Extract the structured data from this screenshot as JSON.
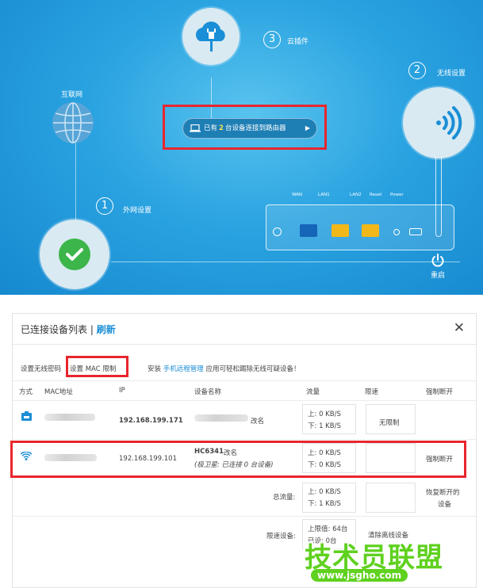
{
  "dashboard": {
    "internet_label": "互联网",
    "wan_settings": {
      "number": "1",
      "label": "外网设置"
    },
    "cloud_plugin": {
      "number": "3",
      "label": "云插件"
    },
    "wireless_settings": {
      "number": "2",
      "label": "无线设置"
    },
    "devices_pill": {
      "prefix": "已有",
      "count": "2",
      "suffix": "台设备连接到路由器",
      "arrow": "▶"
    },
    "router_ports": [
      "WAN",
      "LAN1",
      "LAN2",
      "Reset",
      "Power"
    ],
    "reboot_label": "重启",
    "colors": {
      "background": "#2aa3e1",
      "highlight": "#e8262d",
      "wan_port": "#1565b8",
      "lan_port": "#f2b81a",
      "ok": "#3cb54a"
    }
  },
  "modal": {
    "title": "已连接设备列表",
    "separator": "|",
    "refresh": "刷新",
    "close": "✕",
    "toolbar": {
      "wireless_password": "设置无线密码",
      "mac_limit": "设置 MAC 限制",
      "install_prefix": "安装",
      "remote_app": "手机远程管理",
      "install_suffix": "应用可轻松踢除无线可疑设备！"
    },
    "columns": [
      "方式",
      "MAC地址",
      "IP",
      "设备名称",
      "流量",
      "限速",
      "强制断开"
    ],
    "devices": [
      {
        "type_icon": "lan-icon",
        "ip": "192.168.199.171",
        "rename": "改名",
        "upload": "上: 0 KB/S",
        "download": "下: 1 KB/S",
        "limit": "无限制"
      },
      {
        "type_icon": "wifi-icon",
        "ip": "192.168.199.101",
        "name": "HC6341",
        "rename": "改名",
        "note": "(极卫星: 已连接 0 台设备)",
        "upload": "上: 0 KB/S",
        "download": "下: 0 KB/S",
        "disconnect": "强制断开"
      }
    ],
    "summary": {
      "total_label": "总流量:",
      "total_upload": "上: 0 KB/S",
      "total_download": "下: 1 KB/S",
      "restore_line1": "恢复断开的",
      "restore_line2": "设备",
      "limited_label": "限速设备:",
      "limit_line1": "上限值: 64台",
      "limit_line2": "已设: 0台",
      "clear_offline": "清除离线设备"
    }
  },
  "watermark": {
    "text": "技术员联盟",
    "url": "www.jsgho.com"
  }
}
